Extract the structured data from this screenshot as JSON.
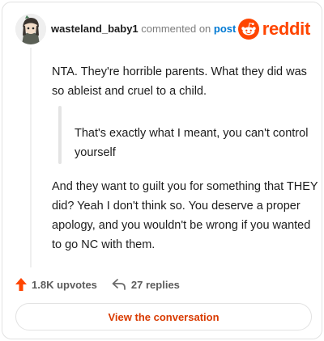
{
  "author": {
    "username": "wasteland_baby1",
    "action": "commented on",
    "target": "post"
  },
  "brand": {
    "wordmark": "reddit",
    "icon": "reddit-alien-icon",
    "color": "#ff4500"
  },
  "comment": {
    "paragraph_1": "NTA. They're horrible parents. What they did was so ableist and cruel to a child.",
    "quote": "That's exactly what I meant, you can't control yourself",
    "paragraph_2": "And they want to guilt you for something that THEY did? Yeah I don't think so. You deserve a proper apology, and you wouldn't be wrong if you wanted to go NC with them."
  },
  "stats": {
    "upvotes": "1.8K upvotes",
    "upvote_icon": "upvote-arrow-icon",
    "replies": "27 replies",
    "reply_icon": "reply-arrow-icon"
  },
  "cta": {
    "label": "View the conversation"
  }
}
